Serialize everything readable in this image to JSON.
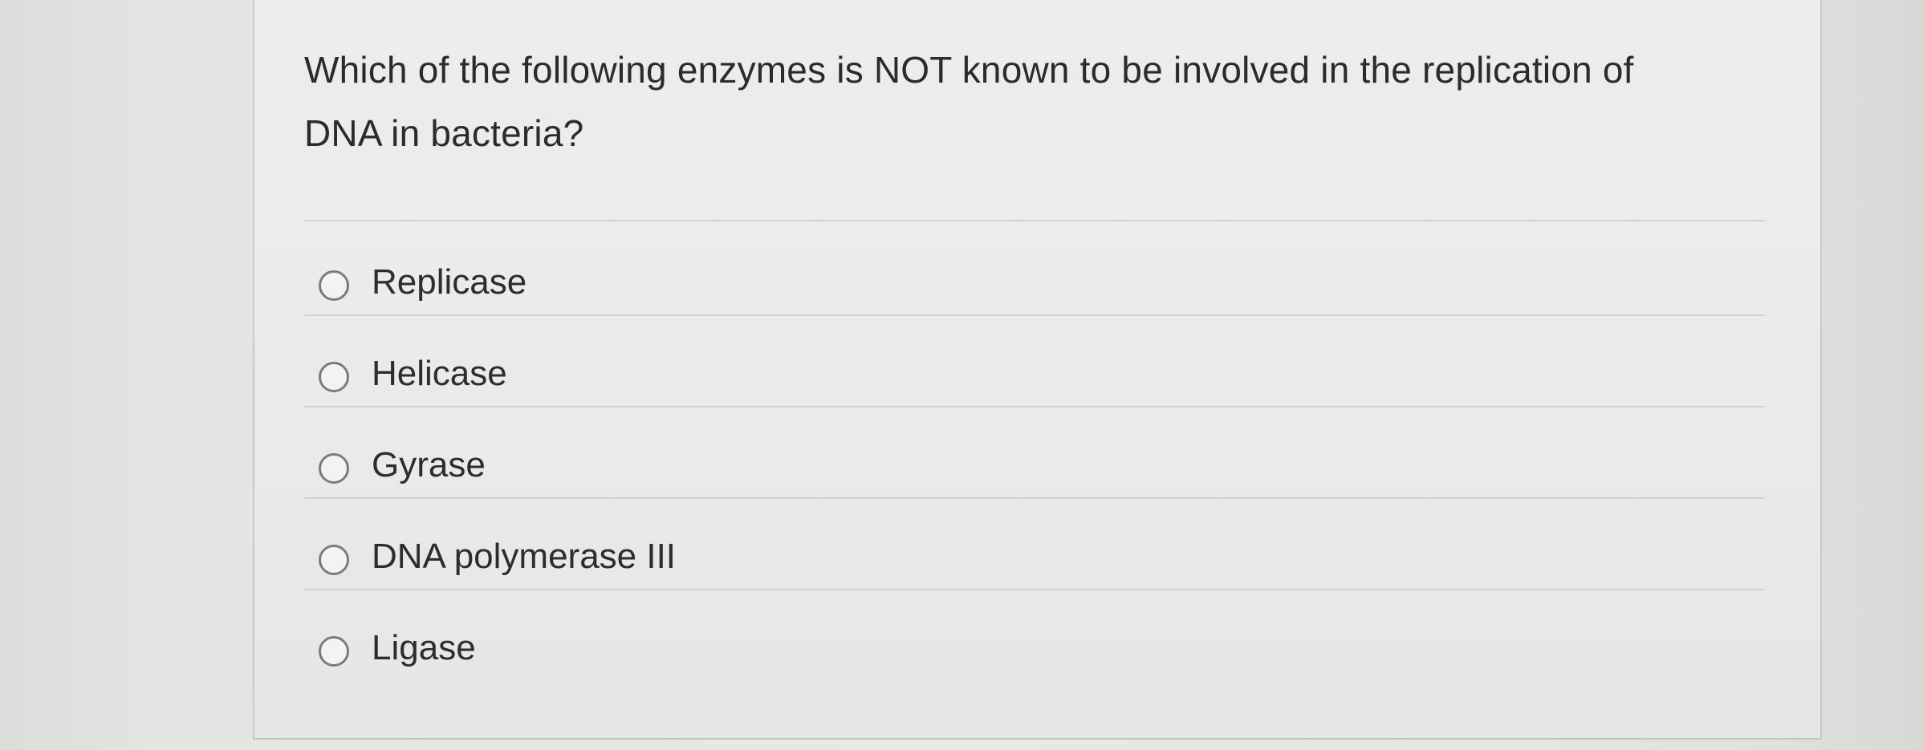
{
  "question": {
    "text": "Which of the following enzymes is NOT known to be involved in the replication of DNA in bacteria?",
    "choices": [
      {
        "label": "Replicase"
      },
      {
        "label": "Helicase"
      },
      {
        "label": "Gyrase"
      },
      {
        "label": "DNA polymerase III"
      },
      {
        "label": "Ligase"
      }
    ]
  },
  "colors": {
    "text": "#2b2b2b",
    "radio_border": "#7b7b7b",
    "divider": "#d2d2d0",
    "card_background": "#ededeb"
  },
  "icons": {
    "radio": "radio-unselected-icon"
  }
}
